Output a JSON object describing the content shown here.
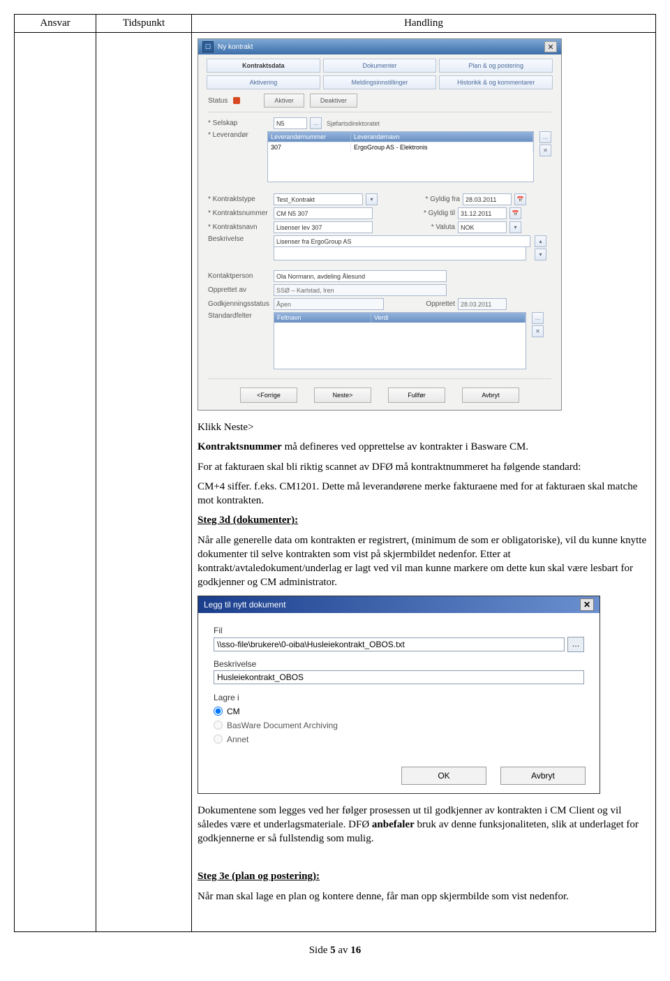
{
  "table": {
    "h1": "Ansvar",
    "h2": "Tidspunkt",
    "h3": "Handling"
  },
  "dlg1": {
    "title": "Ny kontrakt",
    "tabs": [
      "Kontraktsdata",
      "Dokumenter",
      "Plan & og postering",
      "Aktivering",
      "Meldingsinnstillinger",
      "Historikk & og kommentarer"
    ],
    "status_label": "Status",
    "btn_aktiver": "Aktiver",
    "btn_deaktiver": "Deaktiver",
    "labels": {
      "selskap": "* Selskap",
      "leverandor": "* Leverandør",
      "ktype": "* Kontraktstype",
      "knummer": "* Kontraktsnummer",
      "knavn": "* Kontraktsnavn",
      "besk": "Beskrivelse",
      "kperson": "Kontaktperson",
      "oppav": "Opprettet av",
      "godstat": "Godkjenningsstatus",
      "stdfelt": "Standardfelter",
      "gyldfra": "* Gyldig fra",
      "gyldtil": "* Gyldig til",
      "valuta": "* Valuta",
      "opprettet": "Opprettet"
    },
    "vals": {
      "selskap_code": "N5",
      "selskap_txt": "Sjøfartsdirektoratet",
      "lev_ghead1": "Leverandørnummer",
      "lev_ghead2": "Leverandørnavn",
      "lev_num": "307",
      "lev_navn": "ErgoGroup AS - Elektronis",
      "ktype": "Test_Kontrakt",
      "knummer": "CM N5 307",
      "knavn": "Lisenser lev 307",
      "besk": "Lisenser fra ErgoGroup AS",
      "gyldfra": "28.03.2011",
      "gyldtil": "31.12.2011",
      "valuta": "NOK",
      "kperson": "Ola Normann, avdeling Ålesund",
      "oppav": "SSØ – Karlstad, Iren",
      "godstat": "Åpen",
      "opprettet": "28.03.2011",
      "std_h1": "Feltnavn",
      "std_h2": "Verdi"
    },
    "btns": {
      "prev": "<Forrige",
      "next": "Neste>",
      "fullfor": "Fullfør",
      "avbryt": "Avbryt"
    }
  },
  "txt": {
    "p1": "Klikk Neste>",
    "p2a": "Kontraktsnummer",
    "p2b": " må defineres ved opprettelse av kontrakter i Basware CM.",
    "p3": "For at fakturaen skal bli riktig scannet av DFØ må kontraktnummeret ha følgende standard:",
    "p4": "CM+4 siffer. f.eks. CM1201. Dette må leverandørene merke fakturaene med for at fakturaen skal matche mot kontrakten.",
    "step3d": "Steg 3d (dokumenter):",
    "p5": "Når alle generelle data om kontrakten er registrert, (minimum de som er obligatoriske), vil du kunne knytte dokumenter til selve kontrakten som vist på skjermbildet nedenfor. Etter at kontrakt/avtaledokument/underlag er lagt ved vil man kunne markere om dette kun skal være lesbart for godkjenner og CM administrator.",
    "p6a": "Dokumentene som legges ved her følger prosessen ut til godkjenner av kontrakten i CM Client og vil således være et underlagsmateriale. DFØ ",
    "p6b": "anbefaler",
    "p6c": " bruk av denne funksjonaliteten, slik at underlaget for godkjennerne er så fullstendig som mulig.",
    "step3e": "Steg 3e (plan og postering):",
    "p7": "Når man skal lage en plan og kontere denne, får man opp skjermbilde som vist nedenfor."
  },
  "dlg2": {
    "title": "Legg til nytt dokument",
    "fil_label": "Fil",
    "fil_value": "\\\\sso-file\\brukere\\0-oiba\\Husleiekontrakt_OBOS.txt",
    "besk_label": "Beskrivelse",
    "besk_value": "Husleiekontrakt_OBOS",
    "lagre_label": "Lagre i",
    "opt1": "CM",
    "opt2": "BasWare Document Archiving",
    "opt3": "Annet",
    "ok": "OK",
    "avbryt": "Avbryt"
  },
  "footer": {
    "a": "Side ",
    "b": "5",
    "c": " av ",
    "d": "16"
  }
}
